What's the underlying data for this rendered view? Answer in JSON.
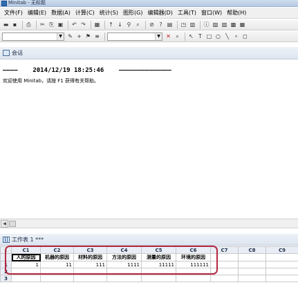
{
  "window": {
    "title": "Minitab - 无标题"
  },
  "menu": [
    "文件(F)",
    "编辑(E)",
    "数据(A)",
    "计算(C)",
    "统计(S)",
    "图形(G)",
    "编辑器(D)",
    "工具(T)",
    "窗口(W)",
    "帮助(H)"
  ],
  "toolbar1": {
    "icons": [
      "folder-open-icon",
      "save-icon",
      "print-icon",
      "cut-icon",
      "copy-icon",
      "paste-icon",
      "undo-icon",
      "redo-icon",
      "worksheet-icon",
      "arrow-up-icon",
      "arrow-down-icon",
      "binoculars-icon",
      "find-icon",
      "cancel-icon",
      "help-icon",
      "notebook-icon",
      "graph-icon",
      "stat-icon",
      "info-icon",
      "session-icon",
      "report-icon",
      "data-icon",
      "window-icon"
    ],
    "glyphs": [
      "▬",
      "▪",
      "⎙",
      "✂",
      "⎘",
      "▣",
      "↶",
      "↷",
      "▦",
      "↑",
      "↓",
      "⚲",
      "⌕",
      "⊘",
      "?",
      "▤",
      "◳",
      "▥",
      "ⓘ",
      "▧",
      "▨",
      "▩",
      "▦"
    ]
  },
  "toolbar2": {
    "icons": [
      "worksheet-combo-icon",
      "brush-icon",
      "crosshair-icon",
      "flag-icon",
      "lines-icon",
      "graph-combo-icon",
      "close-x-icon",
      "zoom-icon",
      "pointer-icon",
      "text-tool-icon",
      "rectangle-icon",
      "ellipse-icon",
      "line-tool-icon",
      "dot-icon",
      "polygon-icon"
    ],
    "glyphs": [
      "",
      "✎",
      "+",
      "⚑",
      "≡",
      "",
      "✕",
      "⌕",
      "↖",
      "T",
      "□",
      "○",
      "╲",
      "∘",
      "◻"
    ],
    "close_color": "#c0141c"
  },
  "session": {
    "title": "会话",
    "timestamp": "————    2014/12/19 18:25:46    ——————————————",
    "welcome": "欢迎使用 Minitab，请按 F1 获得有关帮助。"
  },
  "worksheet": {
    "title": "工作表 1 ***",
    "corner": "↓",
    "columns": [
      "C1",
      "C2",
      "C3",
      "C4",
      "C5",
      "C6",
      "C7",
      "C8",
      "C9"
    ],
    "names": [
      "人的原因",
      "机器的原因",
      "材料的原因",
      "方法的原因",
      "测量的原因",
      "环境的原因",
      "",
      "",
      ""
    ],
    "rows": [
      {
        "num": "1",
        "cells": [
          "1",
          "11",
          "111",
          "1111",
          "11111",
          "111111",
          "",
          "",
          ""
        ]
      },
      {
        "num": "2",
        "cells": [
          "",
          "",
          "",
          "",
          "",
          "",
          "",
          "",
          ""
        ]
      },
      {
        "num": "3",
        "cells": [
          "",
          "",
          "",
          "",
          "",
          "",
          "",
          "",
          ""
        ]
      }
    ]
  },
  "highlight_color": "#b6273f"
}
